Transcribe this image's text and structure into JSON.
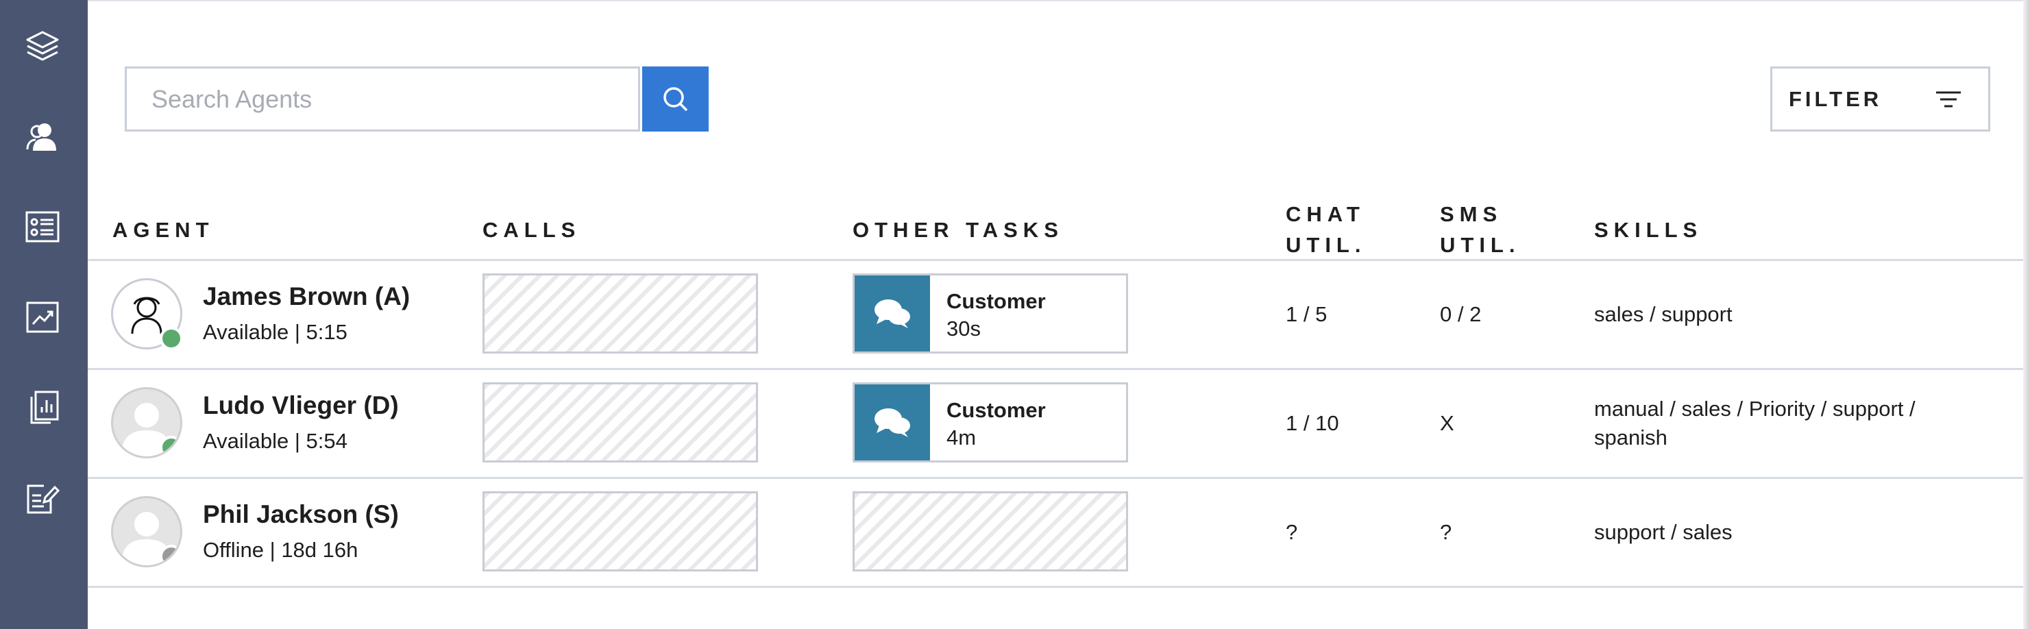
{
  "sidebar": {
    "items": [
      {
        "icon": "layers-icon"
      },
      {
        "icon": "agents-icon"
      },
      {
        "icon": "contact-card-icon"
      },
      {
        "icon": "trend-chart-icon"
      },
      {
        "icon": "report-icon"
      },
      {
        "icon": "edit-form-icon"
      }
    ]
  },
  "search": {
    "placeholder": "Search Agents",
    "value": "",
    "button_icon": "search-icon"
  },
  "filter": {
    "label": "FILTER",
    "icon": "filter-lines-icon"
  },
  "columns": {
    "agent": "AGENT",
    "calls": "CALLS",
    "other_tasks": "OTHER TASKS",
    "chat_util_1": "CHAT",
    "chat_util_2": "UTIL.",
    "sms_util_1": "SMS",
    "sms_util_2": "UTIL.",
    "skills": "SKILLS"
  },
  "agents": [
    {
      "name": "James Brown (A)",
      "status": "Available | 5:15",
      "presence_color": "#5aaa6d",
      "avatar": "outline-person-icon",
      "task": {
        "title": "Customer",
        "time": "30s",
        "icon": "chat-bubbles-icon"
      },
      "chat_util": "1 / 5",
      "sms_util": "0 / 2",
      "skills_line1": "sales / support",
      "skills_line2": ""
    },
    {
      "name": "Ludo Vlieger (D)",
      "status": "Available | 5:54",
      "presence_color": "#5aaa6d",
      "avatar": "default-person-icon",
      "task": {
        "title": "Customer",
        "time": "4m",
        "icon": "chat-bubbles-icon"
      },
      "chat_util": "1 / 10",
      "sms_util": "X",
      "skills_line1": "manual / sales / Priority / support /",
      "skills_line2": "spanish"
    },
    {
      "name": "Phil Jackson (S)",
      "status": "Offline | 18d 16h",
      "presence_color": "#9a9a9a",
      "avatar": "default-person-icon",
      "task": null,
      "chat_util": "?",
      "sms_util": "?",
      "skills_line1": "support / sales",
      "skills_line2": ""
    }
  ],
  "colors": {
    "sidebar": "#4a5571",
    "accent": "#3279d6",
    "task_icon_bg": "#337fa4",
    "available": "#5aaa6d",
    "offline": "#9a9a9a"
  }
}
